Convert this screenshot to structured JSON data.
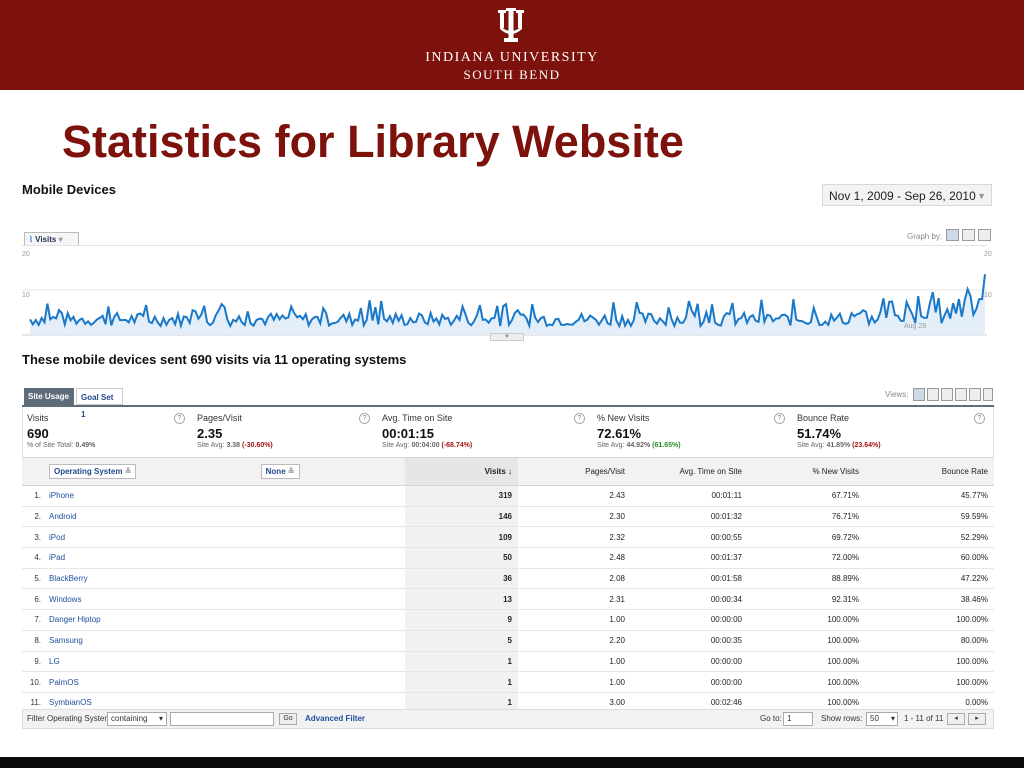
{
  "banner": {
    "university_line1": "INDIANA UNIVERSITY",
    "university_line2": "SOUTH BEND",
    "color": "#7d110c"
  },
  "slide_title": "Statistics for Library Website",
  "section_title": "Mobile Devices",
  "date_range": "Nov 1, 2009 - Sep 26, 2010",
  "graph": {
    "metric_dropdown": "Visits",
    "graph_by_label": "Graph by:",
    "y_labels": [
      "20",
      "10"
    ],
    "x_labels": [
      "Aug 29"
    ]
  },
  "summary_line": "These mobile devices sent 690 visits via 11 operating systems",
  "tabs": [
    "Site Usage",
    "Goal Set 1"
  ],
  "views_label": "Views:",
  "metrics": [
    {
      "name": "Visits",
      "value": "690",
      "sub_prefix": "% of Site Total: ",
      "sub_value": "0.49%",
      "sub_change": ""
    },
    {
      "name": "Pages/Visit",
      "value": "2.35",
      "sub_prefix": "Site Avg: ",
      "sub_value": "3.38",
      "sub_change": "(-30.60%)"
    },
    {
      "name": "Avg. Time on Site",
      "value": "00:01:15",
      "sub_prefix": "Site Avg: ",
      "sub_value": "00:04:00",
      "sub_change": "(-68.74%)"
    },
    {
      "name": "% New Visits",
      "value": "72.61%",
      "sub_prefix": "Site Avg: ",
      "sub_value": "44.92%",
      "sub_change": "(61.65%)"
    },
    {
      "name": "Bounce Rate",
      "value": "51.74%",
      "sub_prefix": "Site Avg: ",
      "sub_value": "41.85%",
      "sub_change": "(23.64%)"
    }
  ],
  "table": {
    "dimension_label": "Operating System",
    "secondary_label": "None",
    "columns": [
      "Visits ↓",
      "Pages/Visit",
      "Avg. Time on Site",
      "% New Visits",
      "Bounce Rate"
    ],
    "rows": [
      {
        "rank": "1.",
        "name": "iPhone",
        "visits": "319",
        "ppv": "2.43",
        "time": "00:01:11",
        "new": "67.71%",
        "bounce": "45.77%"
      },
      {
        "rank": "2.",
        "name": "Android",
        "visits": "146",
        "ppv": "2.30",
        "time": "00:01:32",
        "new": "76.71%",
        "bounce": "59.59%"
      },
      {
        "rank": "3.",
        "name": "iPod",
        "visits": "109",
        "ppv": "2.32",
        "time": "00:00:55",
        "new": "69.72%",
        "bounce": "52.29%"
      },
      {
        "rank": "4.",
        "name": "iPad",
        "visits": "50",
        "ppv": "2.48",
        "time": "00:01:37",
        "new": "72.00%",
        "bounce": "60.00%"
      },
      {
        "rank": "5.",
        "name": "BlackBerry",
        "visits": "36",
        "ppv": "2.08",
        "time": "00:01:58",
        "new": "88.89%",
        "bounce": "47.22%"
      },
      {
        "rank": "6.",
        "name": "Windows",
        "visits": "13",
        "ppv": "2.31",
        "time": "00:00:34",
        "new": "92.31%",
        "bounce": "38.46%"
      },
      {
        "rank": "7.",
        "name": "Danger Hiptop",
        "visits": "9",
        "ppv": "1.00",
        "time": "00:00:00",
        "new": "100.00%",
        "bounce": "100.00%"
      },
      {
        "rank": "8.",
        "name": "Samsung",
        "visits": "5",
        "ppv": "2.20",
        "time": "00:00:35",
        "new": "100.00%",
        "bounce": "80.00%"
      },
      {
        "rank": "9.",
        "name": "LG",
        "visits": "1",
        "ppv": "1.00",
        "time": "00:00:00",
        "new": "100.00%",
        "bounce": "100.00%"
      },
      {
        "rank": "10.",
        "name": "PalmOS",
        "visits": "1",
        "ppv": "1.00",
        "time": "00:00:00",
        "new": "100.00%",
        "bounce": "100.00%"
      },
      {
        "rank": "11.",
        "name": "SymbianOS",
        "visits": "1",
        "ppv": "3.00",
        "time": "00:02:46",
        "new": "100.00%",
        "bounce": "0.00%"
      }
    ]
  },
  "footer": {
    "filter_label": "Filter Operating System:",
    "filter_mode": "containing",
    "filter_value": "",
    "go_label": "Go",
    "advanced_filter": "Advanced Filter",
    "goto_label": "Go to:",
    "goto_value": "1",
    "show_rows_label": "Show rows:",
    "show_rows_value": "50",
    "range_text": "1 - 11 of 11"
  }
}
